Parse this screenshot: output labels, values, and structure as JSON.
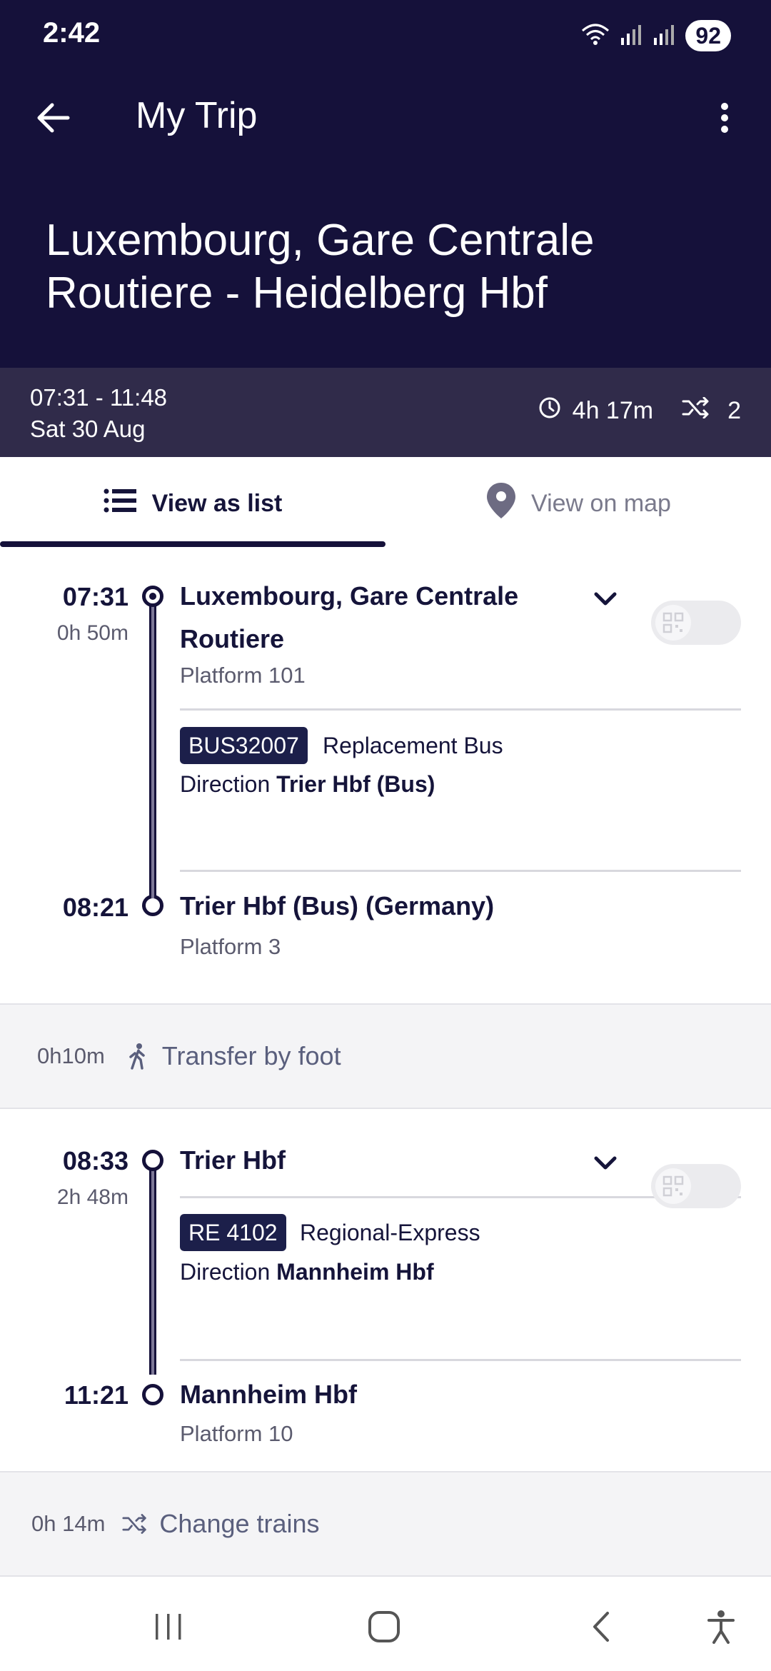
{
  "status": {
    "time": "2:42",
    "battery": "92"
  },
  "appbar": {
    "title": "My Trip"
  },
  "route": {
    "title_line1": "Luxembourg, Gare Centrale",
    "title_line2": "Routiere - Heidelberg Hbf"
  },
  "summary": {
    "time_range": "07:31 - 11:48",
    "date": "Sat 30 Aug",
    "duration": "4h 17m",
    "changes": "2"
  },
  "tabs": {
    "list_label": "View as list",
    "map_label": "View on map"
  },
  "legs": [
    {
      "dep_time": "07:31",
      "duration": "0h 50m",
      "dep_name_line1": "Luxembourg, Gare Centrale",
      "dep_name_line2": "Routiere",
      "dep_platform": "Platform 101",
      "badge": "BUS32007",
      "service": "Replacement Bus",
      "direction_prefix": "Direction",
      "direction": "Trier Hbf (Bus)",
      "arr_time": "08:21",
      "arr_name": "Trier Hbf (Bus) (Germany)",
      "arr_platform": "Platform 3"
    },
    {
      "dep_time": "08:33",
      "duration": "2h 48m",
      "dep_name_line1": "Trier Hbf",
      "badge": "RE 4102",
      "service": "Regional-Express",
      "direction_prefix": "Direction",
      "direction": "Mannheim Hbf",
      "arr_time": "11:21",
      "arr_name": "Mannheim Hbf",
      "arr_platform": "Platform 10"
    }
  ],
  "transfers": [
    {
      "duration": "0h10m",
      "label": "Transfer by foot",
      "icon": "walk-icon"
    },
    {
      "duration": "0h 14m",
      "label": "Change trains",
      "icon": "shuffle-icon"
    }
  ],
  "colors": {
    "header_bg": "#15113a",
    "summary_bg": "#302b4a",
    "badge_bg": "#1c1f4a",
    "transfer_bg": "#f4f4f6"
  }
}
